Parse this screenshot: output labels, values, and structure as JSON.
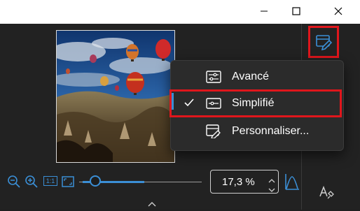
{
  "window": {
    "controls": [
      "minimize",
      "maximize",
      "close"
    ]
  },
  "toolbar": {
    "view_mode_icon": "edit-view-icon"
  },
  "preview": {
    "subject": "hot air balloons over rocky valley"
  },
  "view_menu": {
    "items": [
      {
        "label": "Avancé",
        "icon": "advanced-sliders-icon",
        "checked": false
      },
      {
        "label": "Simplifié",
        "icon": "simplified-panel-icon",
        "checked": true
      },
      {
        "label": "Personnaliser...",
        "icon": "customize-edit-icon",
        "checked": false
      }
    ]
  },
  "zoom": {
    "value": "17,3 %",
    "slider_level": 0.15,
    "one_to_one_label": "1:1"
  },
  "colors": {
    "accent": "#3b8fd6",
    "highlight": "#e0161c",
    "background": "#222222",
    "menu_background": "#2b2b2b"
  }
}
